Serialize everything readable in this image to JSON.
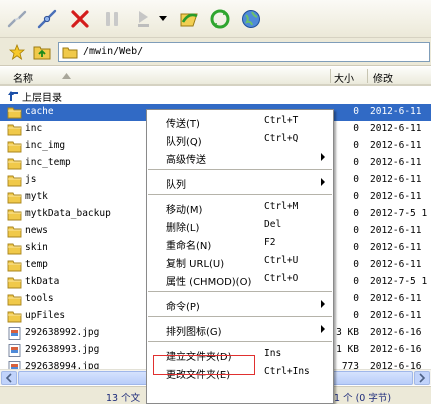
{
  "toolbar": {
    "buttons": [
      {
        "icon": "disconnect-icon"
      },
      {
        "icon": "connect-icon"
      },
      {
        "icon": "stop-icon"
      },
      {
        "icon": "pause-icon"
      },
      {
        "icon": "transfer-icon"
      },
      {
        "icon": "dropdown-arrow-icon"
      },
      {
        "icon": "sync-icon"
      },
      {
        "icon": "refresh-icon"
      },
      {
        "icon": "globe-icon"
      }
    ]
  },
  "address": {
    "path": "/mwin/Web/"
  },
  "columns": {
    "name": "名称",
    "size": "大小",
    "modified": "修改"
  },
  "parent_row": {
    "label": "上层目录"
  },
  "rows": [
    {
      "name": "cache",
      "size": "0",
      "date": "2012-6-11",
      "type": "folder",
      "selected": true
    },
    {
      "name": "inc",
      "size": "0",
      "date": "2012-6-11",
      "type": "folder"
    },
    {
      "name": "inc_img",
      "size": "0",
      "date": "2012-6-11",
      "type": "folder"
    },
    {
      "name": "inc_temp",
      "size": "0",
      "date": "2012-6-11",
      "type": "folder"
    },
    {
      "name": "js",
      "size": "0",
      "date": "2012-6-11",
      "type": "folder"
    },
    {
      "name": "mytk",
      "size": "0",
      "date": "2012-6-11",
      "type": "folder"
    },
    {
      "name": "mytkData_backup",
      "size": "0",
      "date": "2012-7-5 1",
      "type": "folder"
    },
    {
      "name": "news",
      "size": "0",
      "date": "2012-6-11",
      "type": "folder"
    },
    {
      "name": "skin",
      "size": "0",
      "date": "2012-6-11",
      "type": "folder"
    },
    {
      "name": "temp",
      "size": "0",
      "date": "2012-6-11",
      "type": "folder"
    },
    {
      "name": "tkData",
      "size": "0",
      "date": "2012-7-5 1",
      "type": "folder"
    },
    {
      "name": "tools",
      "size": "0",
      "date": "2012-6-11",
      "type": "folder"
    },
    {
      "name": "upFiles",
      "size": "0",
      "date": "2012-6-11",
      "type": "folder"
    },
    {
      "name": "292638992.jpg",
      "size": "3 KB",
      "date": "2012-6-16",
      "type": "image"
    },
    {
      "name": "292638993.jpg",
      "size": "1 KB",
      "date": "2012-6-16",
      "type": "image"
    },
    {
      "name": "292638994.jpg",
      "size": "773",
      "date": "2012-6-16",
      "type": "image"
    }
  ],
  "status": {
    "left": "13 个文",
    "right": "1 个 (0 字节)"
  },
  "context_menu": {
    "items": [
      {
        "label": "传送(T)",
        "shortcut": "Ctrl+T"
      },
      {
        "label": "队列(Q)",
        "shortcut": "Ctrl+Q"
      },
      {
        "label": "高级传送",
        "submenu": true
      },
      {
        "separator": true
      },
      {
        "label": "队列",
        "submenu": true
      },
      {
        "separator": true
      },
      {
        "label": "移动(M)",
        "shortcut": "Ctrl+M"
      },
      {
        "label": "删除(L)",
        "shortcut": "Del"
      },
      {
        "label": "重命名(N)",
        "shortcut": "F2"
      },
      {
        "label": "复制 URL(U)",
        "shortcut": "Ctrl+U"
      },
      {
        "label": "属性 (CHMOD)(O)",
        "shortcut": "Ctrl+O"
      },
      {
        "separator": true
      },
      {
        "label": "命令(P)",
        "submenu": true
      },
      {
        "separator": true
      },
      {
        "label": "排列图标(G)",
        "submenu": true
      },
      {
        "separator": true
      },
      {
        "label": "建立文件夹(D)",
        "shortcut": "Ins",
        "highlighted": true
      },
      {
        "label": "更改文件夹(E)",
        "shortcut": "Ctrl+Ins"
      }
    ]
  },
  "colors": {
    "selection": "#316ac5",
    "highlight_box": "#e0302f",
    "folder": "#f0c94a"
  }
}
